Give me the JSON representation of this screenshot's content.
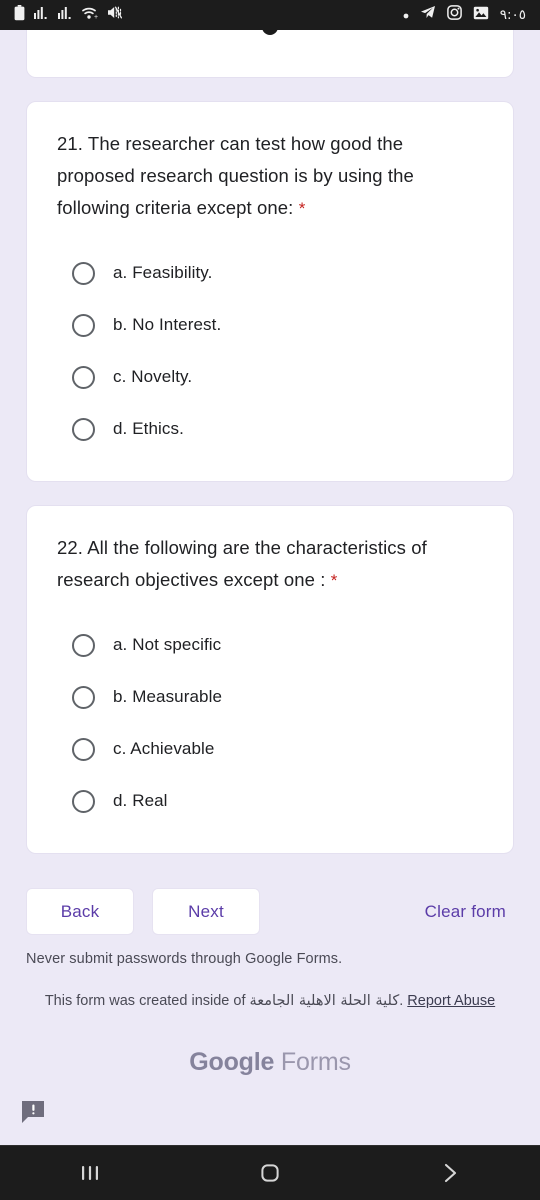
{
  "status_bar": {
    "left_icons": [
      "battery-icon",
      "signal-bars-icon-1",
      "signal-bars-icon-2",
      "wifi-icon",
      "mute-icon"
    ],
    "right_icons": [
      "dot-icon",
      "telegram-icon",
      "instagram-icon",
      "photos-icon"
    ],
    "time": "٩:٠٥"
  },
  "questions": [
    {
      "title": "21. The researcher can test how good the proposed research question is by using the following criteria except one:",
      "required_marker": "*",
      "options": [
        "a. Feasibility.",
        "b. No Interest.",
        "c. Novelty.",
        "d. Ethics."
      ]
    },
    {
      "title": "22. All the following are the characteristics of research objectives except one :",
      "required_marker": "*",
      "options": [
        "a. Not specific",
        "b. Measurable",
        "c. Achievable",
        "d. Real"
      ]
    }
  ],
  "actions": {
    "back_label": "Back",
    "next_label": "Next",
    "clear_form_label": "Clear form"
  },
  "footer": {
    "never_submit": "Never submit passwords through Google Forms.",
    "created_prefix": "This form was created inside of",
    "org_name_arabic": "كلية الحلة الاهلية الجامعة",
    "created_separator": ".",
    "report_abuse_label": "Report Abuse",
    "logo_part1": "Google",
    "logo_part2": "Forms"
  },
  "nav_bar": {
    "recents_icon": "recents-icon",
    "home_icon": "home-icon",
    "back_icon": "back-chevron-icon"
  },
  "colors": {
    "background": "#ece9f6",
    "card": "#ffffff",
    "accent_purple": "#5b3ca8",
    "required_red": "#c5221f",
    "text": "#202124"
  }
}
